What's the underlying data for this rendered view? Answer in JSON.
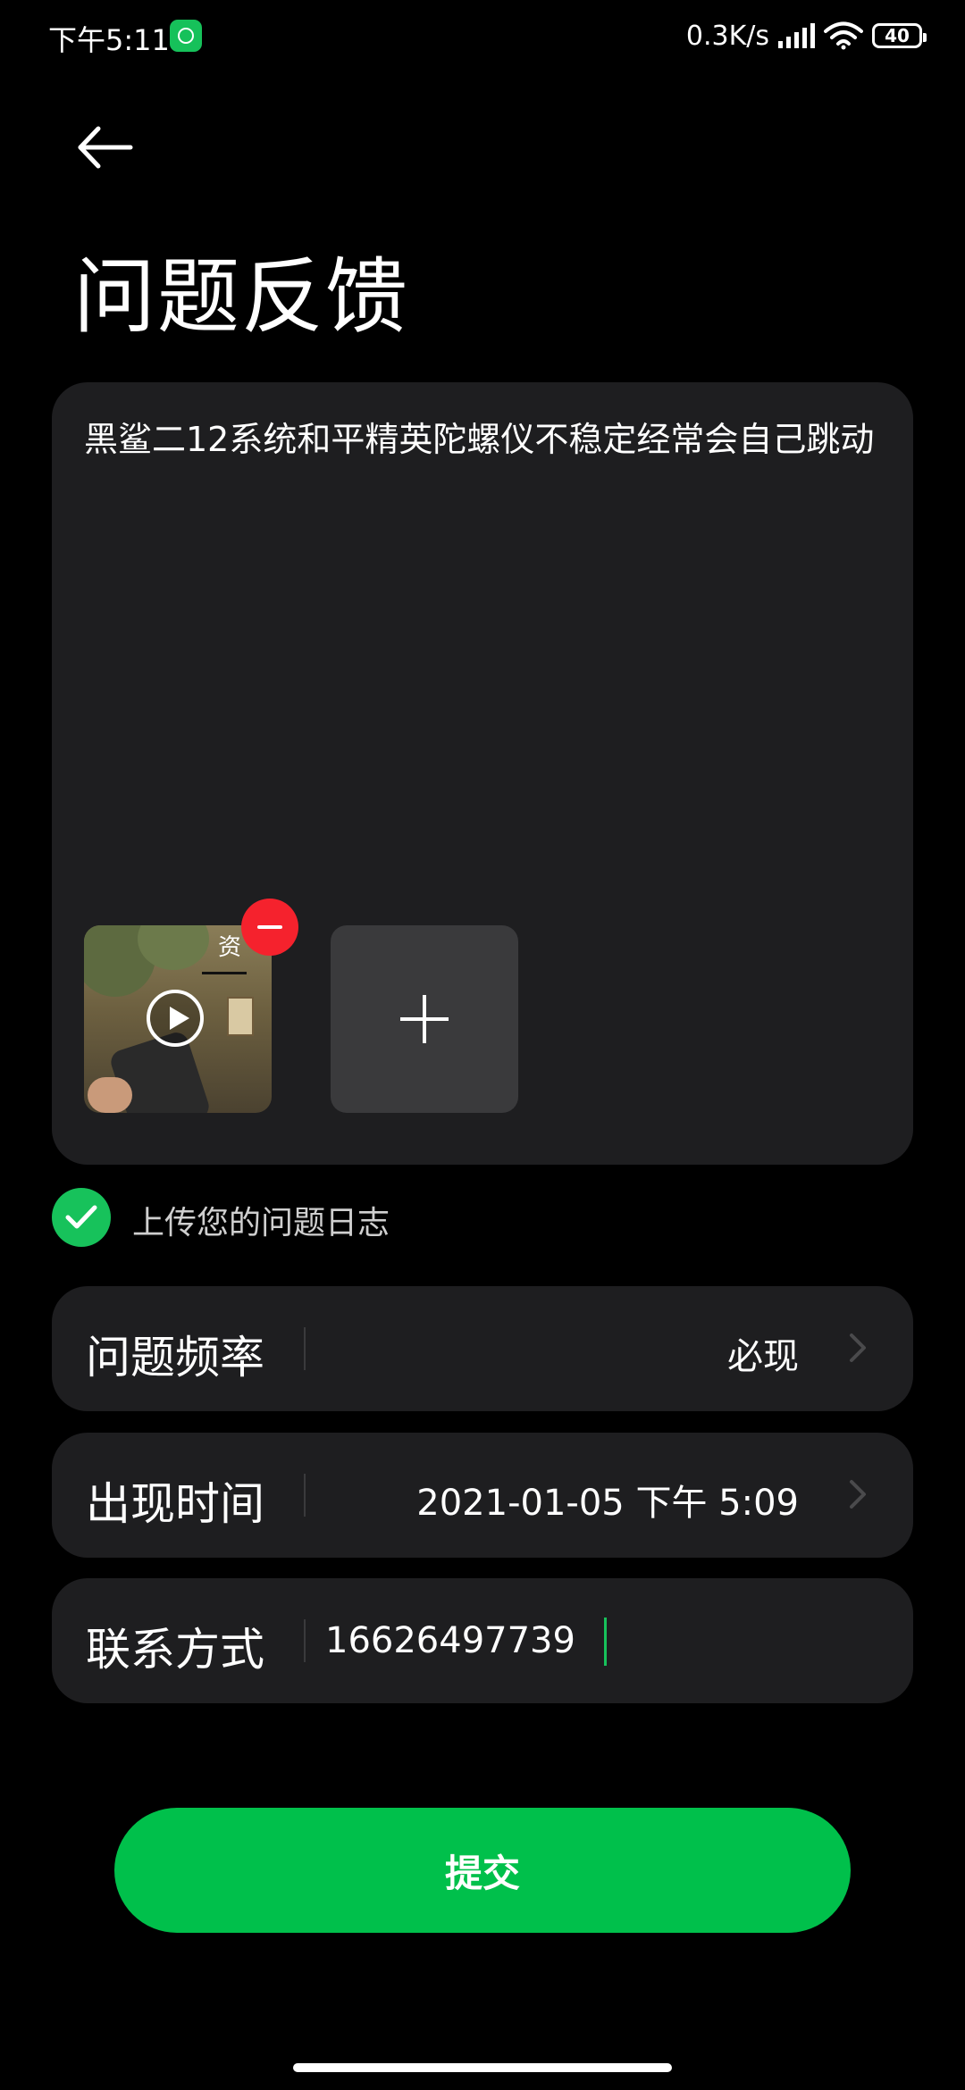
{
  "status_bar": {
    "time": "下午5:11",
    "network_speed": "0.3K/s",
    "battery": "40",
    "app_icon": "speedometer-icon",
    "signal_icon": "signal-icon",
    "wifi_icon": "wifi-icon"
  },
  "header": {
    "back_icon": "back-arrow-icon",
    "title": "问题反馈"
  },
  "feedback": {
    "description": "黑鲨二12系统和平精英陀螺仪不稳定经常会自己跳动",
    "attachment": {
      "type": "video",
      "overlay_text": "资",
      "icon": "play-icon"
    },
    "remove_icon": "remove-icon",
    "add_icon": "plus-icon"
  },
  "upload_log": {
    "checked": true,
    "label": "上传您的问题日志"
  },
  "form": {
    "frequency": {
      "label": "问题频率",
      "value": "必现"
    },
    "time": {
      "label": "出现时间",
      "value": "2021-01-05 下午 5:09"
    },
    "contact": {
      "label": "联系方式",
      "value": "16626497739"
    }
  },
  "submit_label": "提交",
  "colors": {
    "background": "#000000",
    "card": "#1e1e20",
    "accent_green": "#00c04b",
    "remove_red": "#f5222d"
  }
}
